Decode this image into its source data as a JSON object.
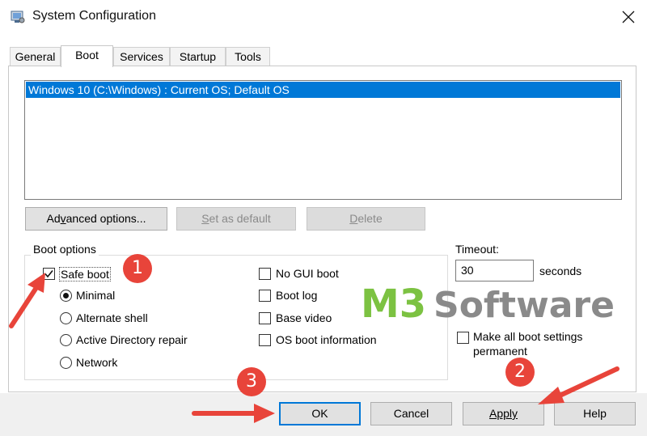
{
  "window": {
    "title": "System Configuration"
  },
  "tabs": [
    {
      "label": "General"
    },
    {
      "label": "Boot"
    },
    {
      "label": "Services"
    },
    {
      "label": "Startup"
    },
    {
      "label": "Tools"
    }
  ],
  "os_list": {
    "items": [
      "Windows 10 (C:\\Windows) : Current OS; Default OS"
    ]
  },
  "buttons": {
    "advanced_pre": "Ad",
    "advanced_key": "v",
    "advanced_post": "anced options...",
    "set_default_pre": "",
    "set_default_key": "S",
    "set_default_post": "et as default",
    "delete_pre": "",
    "delete_key": "D",
    "delete_post": "elete"
  },
  "boot_options": {
    "title": "Boot options",
    "safe_boot": {
      "label": "Safe boot",
      "checked": true
    },
    "minimal": {
      "label": "Minimal",
      "selected": true
    },
    "alternate_shell": {
      "label": "Alternate shell"
    },
    "ad_repair": {
      "label": "Active Directory repair"
    },
    "network": {
      "label": "Network"
    },
    "no_gui_boot": {
      "label": "No GUI boot"
    },
    "boot_log": {
      "label": "Boot log"
    },
    "base_video": {
      "label": "Base video"
    },
    "os_boot_info": {
      "label": "OS boot information"
    }
  },
  "timeout": {
    "label": "Timeout:",
    "value": "30",
    "unit": "seconds"
  },
  "make_permanent": {
    "line1": "Make all boot settings",
    "line2": "permanent"
  },
  "footer": {
    "ok": "OK",
    "cancel": "Cancel",
    "apply": "Apply",
    "help": "Help"
  },
  "annotations": {
    "step1": "1",
    "step2": "2",
    "step3": "3",
    "arrow_color": "#e8443a"
  },
  "watermark": {
    "text_m3": "M3",
    "text_software": "Software",
    "color_green": "#7cc242",
    "color_gray": "#8a8a8a"
  }
}
